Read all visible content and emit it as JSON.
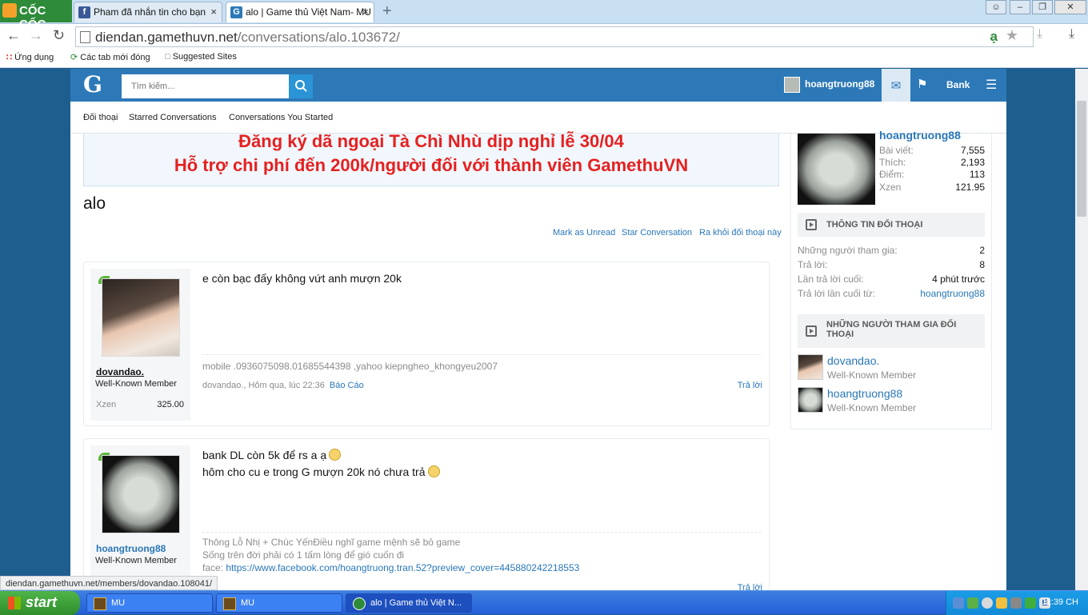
{
  "browser": {
    "logo": "CỐC CỐC",
    "tabs": [
      {
        "label": "Pham đã nhắn tin cho bạn",
        "icon": "facebook-icon"
      },
      {
        "label": "alo | Game thủ Việt Nam- MU",
        "icon": "gamethuvn-icon"
      }
    ],
    "url_domain": "diendan.gamethuvn.net",
    "url_path": "/conversations/alo.103672/",
    "bookmarks": [
      "Ứng dụng",
      "Các tab mới đóng",
      "Suggested Sites"
    ]
  },
  "site": {
    "logo": "G",
    "search_placeholder": "Tìm kiếm...",
    "username": "hoangtruong88",
    "bank": "Bank",
    "subnav": [
      "Đối thoại",
      "Starred Conversations",
      "Conversations You Started"
    ]
  },
  "banner": {
    "line1": "Đăng ký dã ngoại Tà Chì Nhù dịp nghỉ lễ 30/04",
    "line2": "Hỗ trợ chi phí đến 200k/người đối với thành viên GamethuVN"
  },
  "conversation": {
    "title": "alo",
    "actions": [
      "Mark as Unread",
      "Star Conversation",
      "Ra khỏi đối thoại này"
    ]
  },
  "messages": [
    {
      "author": "dovandao.",
      "user_title": "Well-Known Member",
      "stat_label": "Xzen",
      "stat_value": "325.00",
      "text": "e còn bạc đấy không vứt anh mượn 20k",
      "signature": "mobile .0936075098.01685544398 ,yahoo kiepngheo_khongyeu2007",
      "meta": "dovandao., Hôm qua, lúc 22:36",
      "report": "Báo Cáo",
      "reply": "Trả lời"
    },
    {
      "author": "hoangtruong88",
      "user_title": "Well-Known Member",
      "line1": "bank DL còn 5k để rs a ạ",
      "line2": "hôm cho cu e trong G mượn 20k nó chưa trả",
      "sig1": "Thông Lỗ Nhị + Chúc YếnĐiều nghĩ game mệnh sẽ bỏ game",
      "sig2": "Sống trên đời phải có 1 tấm lòng để gió cuốn đi",
      "sig3_label": "face:",
      "sig3_link": "https://www.facebook.com/hoangtruong.tran.52?preview_cover=445880242218553",
      "reply": "Trả lời"
    }
  ],
  "sidebar": {
    "username": "hoangtruong88",
    "stats": [
      {
        "label": "Bài viết:",
        "value": "7,555"
      },
      {
        "label": "Thích:",
        "value": "2,193"
      },
      {
        "label": "Điểm:",
        "value": "113"
      },
      {
        "label": "Xzen",
        "value": "121.95"
      }
    ],
    "info_title": "THÔNG TIN ĐỐI THOẠI",
    "info": [
      {
        "label": "Những người tham gia:",
        "value": "2"
      },
      {
        "label": "Trả lời:",
        "value": "8"
      },
      {
        "label": "Lần trả lời cuối:",
        "value": "4 phút trước"
      },
      {
        "label": "Trả lời lần cuối từ:",
        "value": "hoangtruong88"
      }
    ],
    "participants_title": "NHỮNG NGƯỜI THAM GIA ĐỐI THOẠI",
    "participants": [
      {
        "name": "dovandao.",
        "title": "Well-Known Member"
      },
      {
        "name": "hoangtruong88",
        "title": "Well-Known Member"
      }
    ]
  },
  "status_url": "diendan.gamethuvn.net/members/dovandao.108041/",
  "taskbar": {
    "start": "start",
    "tasks": [
      "MU",
      "MU",
      "alo | Game thủ Việt N..."
    ],
    "clock": "11:39 CH"
  }
}
